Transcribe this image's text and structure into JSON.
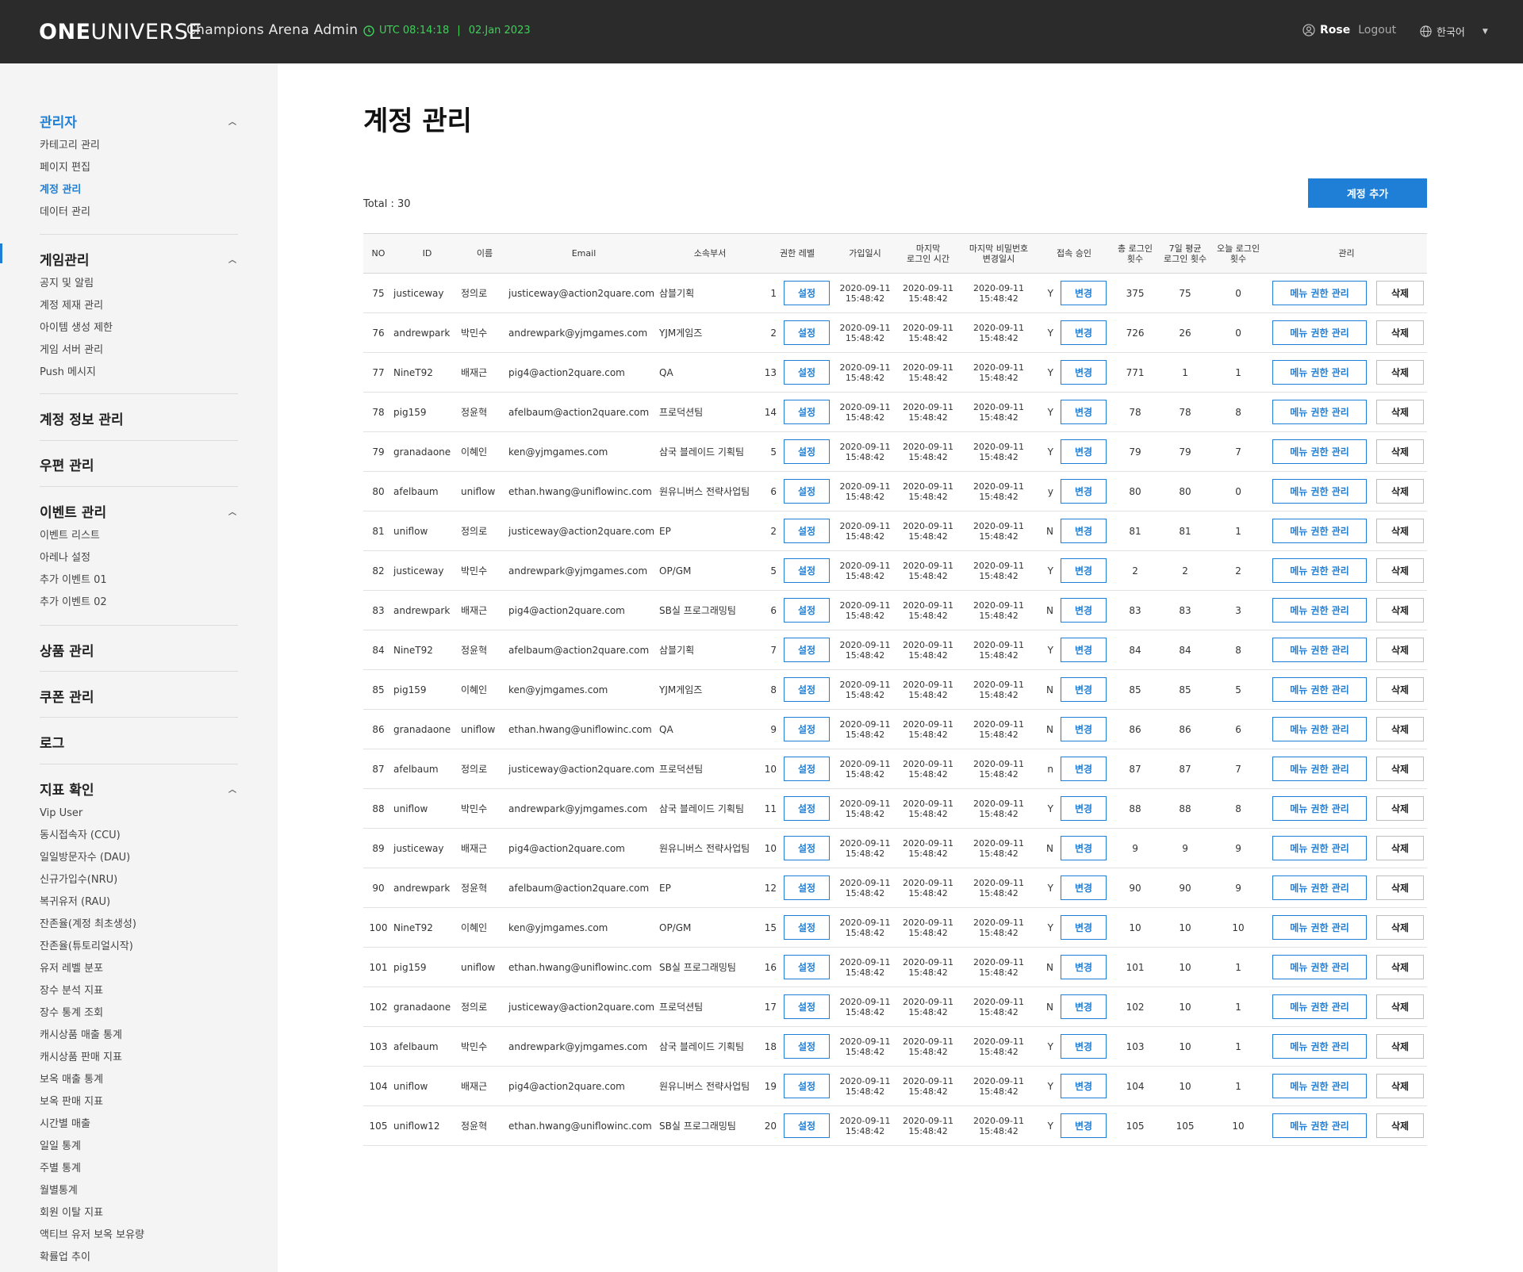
{
  "header": {
    "logo_bold": "ONE",
    "logo_rest": "UNIVERSE",
    "app_title": "Champions Arena Admin",
    "clock_time": "UTC 08:14:18",
    "clock_sep": "|",
    "clock_date": "02.Jan 2023",
    "user_name": "Rose",
    "logout_label": "Logout",
    "language": "한국어",
    "accent_color": "#3fcf5a"
  },
  "sidebar": {
    "groups": [
      {
        "title": "관리자",
        "items": [
          "카테고리 관리",
          "페이지 편집",
          "계정 관리",
          "데이터 관리"
        ]
      },
      {
        "title": "게임관리",
        "items": [
          "공지 및 알림",
          "계정 제재 관리",
          "아이템 생성 제한",
          "게임 서버 관리",
          "Push 메시지"
        ]
      },
      {
        "title": "계정 정보 관리",
        "items": []
      },
      {
        "title": "우편 관리",
        "items": []
      },
      {
        "title": "이벤트 관리",
        "items": [
          "이벤트 리스트",
          "아레나 설정",
          "추가 이벤트 01",
          "추가 이벤트 02"
        ]
      },
      {
        "title": "상품 관리",
        "items": []
      },
      {
        "title": "쿠폰 관리",
        "items": []
      },
      {
        "title": "로그",
        "items": []
      },
      {
        "title": "지표 확인",
        "items": [
          "Vip User",
          "동시접속자 (CCU)",
          "일일방문자수 (DAU)",
          "신규가입수(NRU)",
          "복귀유저 (RAU)",
          "잔존율(계정 최초생성)",
          "잔존율(튜토리얼시작)",
          "유저 레벨 분포",
          "장수 분석 지표",
          "장수 통계 조회",
          "캐시상품 매출 통계",
          "캐시상품 판매 지표",
          "보옥 매출 통계",
          "보옥 판매 지표",
          "시간별 매출",
          "일일 통계",
          "주별 통계",
          "월별통계",
          "회원 이탈 지표",
          "액티브 유저 보옥 보유량",
          "확률업 추이"
        ]
      }
    ],
    "active_item": "계정 관리",
    "accent_color": "#1f7fd6"
  },
  "main": {
    "page_title": "계정 관리",
    "total_label": "Total : 30",
    "add_button": "계정 추가",
    "columns": [
      "NO",
      "ID",
      "이름",
      "Email",
      "소속부서",
      "권한 레벨",
      "가입일시",
      "마지막\n로그인 시간",
      "마지막 비밀번호\n변경일시",
      "접속 승인",
      "총 로그인\n횟수",
      "7일 평균\n로그인 횟수",
      "오늘 로그인\n횟수",
      "관리"
    ],
    "set_label": "설정",
    "change_label": "변경",
    "menu_label": "메뉴 권한 관리",
    "delete_label": "삭제",
    "date_line1": "2020-09-11",
    "date_line2": "15:48:42",
    "rows": [
      {
        "no": "75",
        "id": "justiceway",
        "name": "정의로",
        "email": "justiceway@action2quare.com",
        "dept": "삼블기획",
        "level": "1",
        "approve": "Y",
        "total": "375",
        "avg7": "75",
        "today": "0"
      },
      {
        "no": "76",
        "id": "andrewpark",
        "name": "박민수",
        "email": "andrewpark@yjmgames.com",
        "dept": "YJM게임즈",
        "level": "2",
        "approve": "Y",
        "total": "726",
        "avg7": "26",
        "today": "0"
      },
      {
        "no": "77",
        "id": "NineT92",
        "name": "배재근",
        "email": "pig4@action2quare.com",
        "dept": "QA",
        "level": "13",
        "approve": "Y",
        "total": "771",
        "avg7": "1",
        "today": "1"
      },
      {
        "no": "78",
        "id": "pig159",
        "name": "정윤혁",
        "email": "afelbaum@action2quare.com",
        "dept": "프로덕션팀",
        "level": "14",
        "approve": "Y",
        "total": "78",
        "avg7": "78",
        "today": "8"
      },
      {
        "no": "79",
        "id": "granadaone",
        "name": "이혜인",
        "email": "ken@yjmgames.com",
        "dept": "삼국 블레이드 기획팀",
        "level": "5",
        "approve": "Y",
        "total": "79",
        "avg7": "79",
        "today": "7"
      },
      {
        "no": "80",
        "id": "afelbaum",
        "name": "uniflow",
        "email": "ethan.hwang@uniflowinc.com",
        "dept": "원유니버스 전략사업팀",
        "level": "6",
        "approve": "y",
        "total": "80",
        "avg7": "80",
        "today": "0"
      },
      {
        "no": "81",
        "id": "uniflow",
        "name": "정의로",
        "email": "justiceway@action2quare.com",
        "dept": "EP",
        "level": "2",
        "approve": "N",
        "total": "81",
        "avg7": "81",
        "today": "1"
      },
      {
        "no": "82",
        "id": "justiceway",
        "name": "박민수",
        "email": "andrewpark@yjmgames.com",
        "dept": "OP/GM",
        "level": "5",
        "approve": "Y",
        "total": "2",
        "avg7": "2",
        "today": "2"
      },
      {
        "no": "83",
        "id": "andrewpark",
        "name": "배재근",
        "email": "pig4@action2quare.com",
        "dept": "SB실 프로그래밍팀",
        "level": "6",
        "approve": "N",
        "total": "83",
        "avg7": "83",
        "today": "3"
      },
      {
        "no": "84",
        "id": "NineT92",
        "name": "정윤혁",
        "email": "afelbaum@action2quare.com",
        "dept": "삼블기획",
        "level": "7",
        "approve": "Y",
        "total": "84",
        "avg7": "84",
        "today": "8"
      },
      {
        "no": "85",
        "id": "pig159",
        "name": "이혜인",
        "email": "ken@yjmgames.com",
        "dept": "YJM게임즈",
        "level": "8",
        "approve": "N",
        "total": "85",
        "avg7": "85",
        "today": "5"
      },
      {
        "no": "86",
        "id": "granadaone",
        "name": "uniflow",
        "email": "ethan.hwang@uniflowinc.com",
        "dept": "QA",
        "level": "9",
        "approve": "N",
        "total": "86",
        "avg7": "86",
        "today": "6"
      },
      {
        "no": "87",
        "id": "afelbaum",
        "name": "정의로",
        "email": "justiceway@action2quare.com",
        "dept": "프로덕션팀",
        "level": "10",
        "approve": "n",
        "total": "87",
        "avg7": "87",
        "today": "7"
      },
      {
        "no": "88",
        "id": "uniflow",
        "name": "박민수",
        "email": "andrewpark@yjmgames.com",
        "dept": "삼국 블레이드 기획팀",
        "level": "11",
        "approve": "Y",
        "total": "88",
        "avg7": "88",
        "today": "8"
      },
      {
        "no": "89",
        "id": "justiceway",
        "name": "배재근",
        "email": "pig4@action2quare.com",
        "dept": "원유니버스 전략사업팀",
        "level": "10",
        "approve": "N",
        "total": "9",
        "avg7": "9",
        "today": "9"
      },
      {
        "no": "90",
        "id": "andrewpark",
        "name": "정윤혁",
        "email": "afelbaum@action2quare.com",
        "dept": "EP",
        "level": "12",
        "approve": "Y",
        "total": "90",
        "avg7": "90",
        "today": "9"
      },
      {
        "no": "100",
        "id": "NineT92",
        "name": "이혜인",
        "email": "ken@yjmgames.com",
        "dept": "OP/GM",
        "level": "15",
        "approve": "Y",
        "total": "10",
        "avg7": "10",
        "today": "10"
      },
      {
        "no": "101",
        "id": "pig159",
        "name": "uniflow",
        "email": "ethan.hwang@uniflowinc.com",
        "dept": "SB실 프로그래밍팀",
        "level": "16",
        "approve": "N",
        "total": "101",
        "avg7": "10",
        "today": "1"
      },
      {
        "no": "102",
        "id": "granadaone",
        "name": "정의로",
        "email": "justiceway@action2quare.com",
        "dept": "프로덕션팀",
        "level": "17",
        "approve": "N",
        "total": "102",
        "avg7": "10",
        "today": "1"
      },
      {
        "no": "103",
        "id": "afelbaum",
        "name": "박민수",
        "email": "andrewpark@yjmgames.com",
        "dept": "삼국 블레이드 기획팀",
        "level": "18",
        "approve": "Y",
        "total": "103",
        "avg7": "10",
        "today": "1"
      },
      {
        "no": "104",
        "id": "uniflow",
        "name": "배재근",
        "email": "pig4@action2quare.com",
        "dept": "원유니버스 전략사업팀",
        "level": "19",
        "approve": "Y",
        "total": "104",
        "avg7": "10",
        "today": "1"
      },
      {
        "no": "105",
        "id": "uniflow12",
        "name": "정윤혁",
        "email": "ethan.hwang@uniflowinc.com",
        "dept": "SB실 프로그래밍팀",
        "level": "20",
        "approve": "Y",
        "total": "105",
        "avg7": "105",
        "today": "10"
      }
    ]
  }
}
